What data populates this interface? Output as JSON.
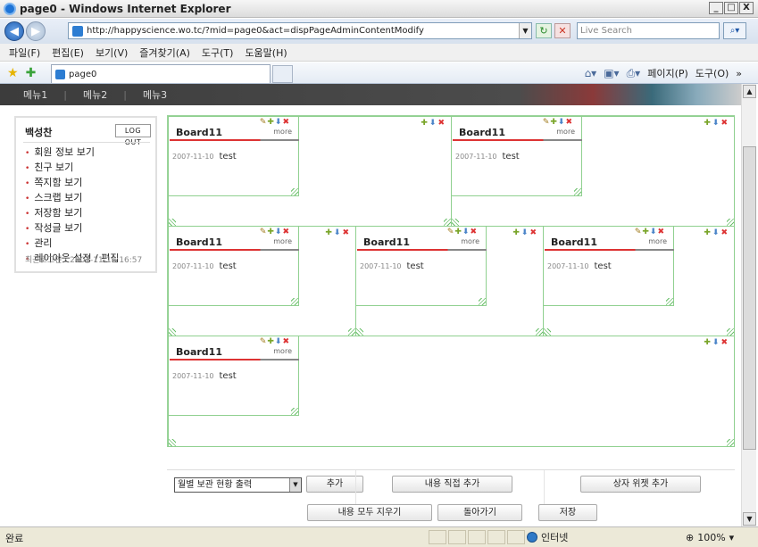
{
  "window": {
    "title": "page0 - Windows Internet Explorer",
    "min": "_",
    "max": "□",
    "close": "X"
  },
  "address": {
    "url": "http://happyscience.wo.tc/?mid=page0&act=dispPageAdminContentModify",
    "search_placeholder": "Live Search"
  },
  "menubar": [
    "파일(F)",
    "편집(E)",
    "보기(V)",
    "즐겨찾기(A)",
    "도구(T)",
    "도움말(H)"
  ],
  "tab": {
    "label": "page0"
  },
  "commands": {
    "page": "페이지(P)",
    "tools": "도구(O)"
  },
  "site_nav": [
    "메뉴1",
    "메뉴2",
    "메뉴3"
  ],
  "sidebar": {
    "user_name": "백성찬",
    "logout_label": "LOG OUT",
    "items": [
      "회원 정보 보기",
      "친구 보기",
      "쪽지함 보기",
      "스크랩 보기",
      "저장함 보기",
      "작성글 보기",
      "관리",
      "레이아웃 설정 / 편집"
    ],
    "last_login": "최근로그인 : 2007-11-16 16:57"
  },
  "widgets": [
    {
      "title": "Board11",
      "more": "more",
      "date": "2007-11-10",
      "text": "test"
    },
    {
      "title": "Board11",
      "more": "more",
      "date": "2007-11-10",
      "text": "test"
    },
    {
      "title": "Board11",
      "more": "more",
      "date": "2007-11-10",
      "text": "test"
    },
    {
      "title": "Board11",
      "more": "more",
      "date": "2007-11-10",
      "text": "test"
    },
    {
      "title": "Board11",
      "more": "more",
      "date": "2007-11-10",
      "text": "test"
    },
    {
      "title": "Board11",
      "more": "more",
      "date": "2007-11-10",
      "text": "test"
    }
  ],
  "toolbar": {
    "select_value": "월별 보관 현황 출력",
    "add": "추가",
    "add_content": "내용 직접 추가",
    "add_box_widget": "상자 위젯 추가",
    "clear_all": "내용 모두 지우기",
    "back": "돌아가기",
    "save": "저장"
  },
  "status": {
    "text": "완료",
    "zone": "인터넷",
    "zoom": "100%"
  },
  "icons": [
    "ie-icon",
    "back-icon",
    "forward-icon",
    "refresh-icon",
    "stop-icon",
    "search-icon",
    "star-icon",
    "add-favorite-icon",
    "home-icon",
    "print-icon",
    "edit-icon",
    "add-icon",
    "down-icon",
    "delete-icon",
    "globe-icon"
  ],
  "colors": {
    "accent_red": "#dd3333",
    "zone_border": "#8fd08f",
    "nav_bg": "#3c3c3c"
  }
}
